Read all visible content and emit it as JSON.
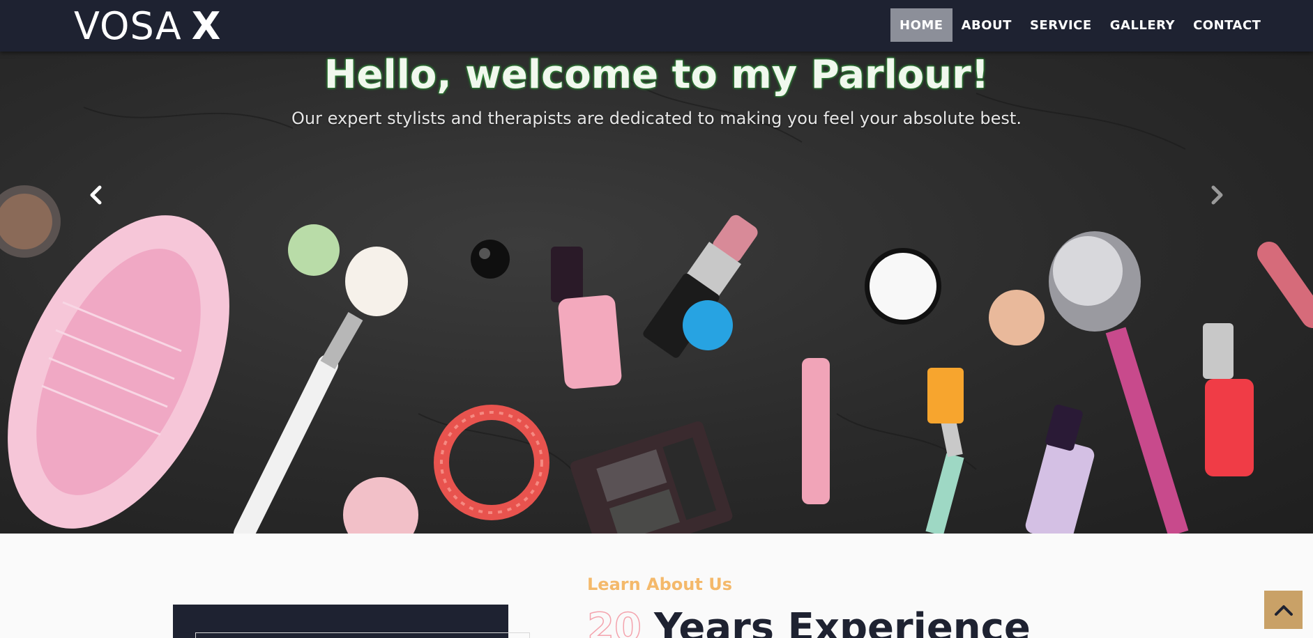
{
  "brand": {
    "name": "VOSA",
    "mark": "X"
  },
  "nav": {
    "items": [
      {
        "label": "HOME",
        "active": true
      },
      {
        "label": "ABOUT",
        "active": false
      },
      {
        "label": "SERVICE",
        "active": false
      },
      {
        "label": "GALLERY",
        "active": false
      },
      {
        "label": "CONTACT",
        "active": false
      }
    ]
  },
  "hero": {
    "title": "Hello, welcome to my Parlour!",
    "subtitle": "Our expert stylists and therapists are dedicated to making you feel your absolute best.",
    "prev_icon": "chevron-left-icon",
    "next_icon": "chevron-right-icon"
  },
  "about": {
    "eyebrow": "Learn About Us",
    "years": "20",
    "heading": "Years Experience"
  },
  "back_to_top": {
    "icon": "chevron-up-icon"
  },
  "colors": {
    "navbar": "#1e2231",
    "nav_active": "#8c8f99",
    "accent_gold": "#f4b96b",
    "back_to_top": "#c9a167",
    "years_outline": "#f4a3ad"
  }
}
